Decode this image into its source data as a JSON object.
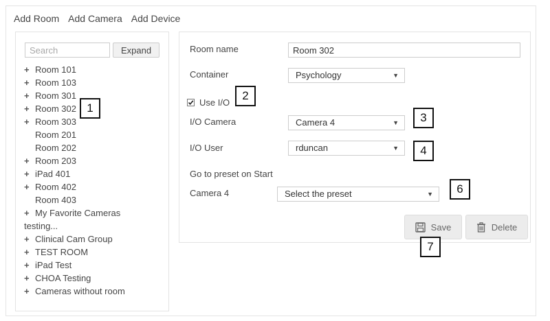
{
  "toplinks": [
    "Add Room",
    "Add Camera",
    "Add Device"
  ],
  "sidebar": {
    "search_placeholder": "Search",
    "expand_label": "Expand",
    "items": [
      {
        "label": "Room 101",
        "expandable": true
      },
      {
        "label": "Room 103",
        "expandable": true
      },
      {
        "label": "Room 301",
        "expandable": true
      },
      {
        "label": "Room 302",
        "expandable": true
      },
      {
        "label": "Room 303",
        "expandable": true
      },
      {
        "label": "Room 201",
        "expandable": false
      },
      {
        "label": "Room 202",
        "expandable": false
      },
      {
        "label": "Room 203",
        "expandable": true
      },
      {
        "label": "iPad 401",
        "expandable": true
      },
      {
        "label": "Room 402",
        "expandable": true
      },
      {
        "label": "Room 403",
        "expandable": false
      },
      {
        "label": "My Favorite Cameras",
        "expandable": true
      },
      {
        "label": "testing...",
        "expandable": false,
        "flush": true
      },
      {
        "label": "Clinical Cam Group",
        "expandable": true
      },
      {
        "label": "TEST ROOM",
        "expandable": true
      },
      {
        "label": "iPad Test",
        "expandable": true
      },
      {
        "label": "CHOA Testing",
        "expandable": true
      },
      {
        "label": "Cameras without room",
        "expandable": true
      }
    ]
  },
  "form": {
    "room_name_label": "Room name",
    "room_name_value": "Room 302",
    "container_label": "Container",
    "container_value": "Psychology",
    "use_io_label": "Use I/O",
    "use_io_checked": true,
    "io_camera_label": "I/O Camera",
    "io_camera_value": "Camera 4",
    "io_user_label": "I/O User",
    "io_user_value": "rduncan",
    "preset_heading": "Go to preset on Start",
    "preset_camera_label": "Camera 4",
    "preset_select_value": "Select the preset",
    "save_label": "Save",
    "delete_label": "Delete"
  },
  "callouts": [
    "1",
    "2",
    "3",
    "4",
    "6",
    "7"
  ]
}
